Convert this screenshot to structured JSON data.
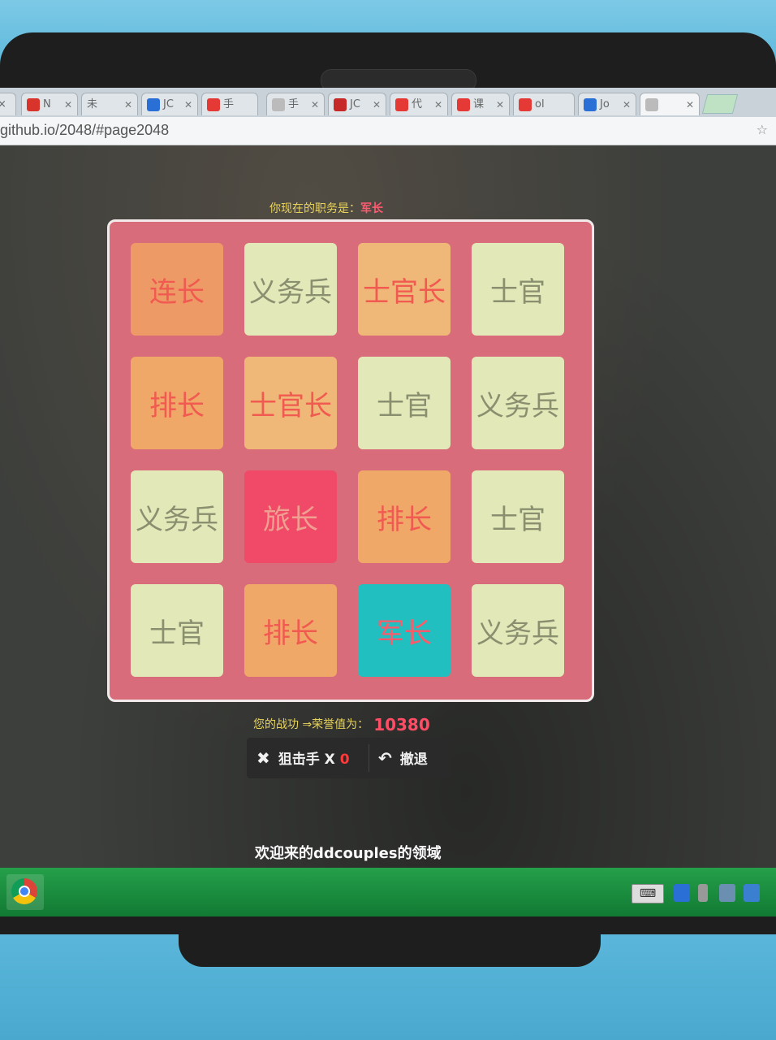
{
  "browser": {
    "tabs": [
      {
        "label": "×",
        "icon_color": "#dddddd"
      },
      {
        "label": "N",
        "icon_color": "#d9342b"
      },
      {
        "label": "未",
        "icon_color": "#dddddd"
      },
      {
        "label": "JC",
        "icon_color": "#2a6fd6"
      },
      {
        "label": "手",
        "icon_color": "#e53935"
      },
      {
        "label": "手",
        "icon_color": "#bbbbbb"
      },
      {
        "label": "JC",
        "icon_color": "#c62828"
      },
      {
        "label": "代",
        "icon_color": "#e53935"
      },
      {
        "label": "课",
        "icon_color": "#e53935"
      },
      {
        "label": "ol",
        "icon_color": "#e53935"
      },
      {
        "label": "Jo",
        "icon_color": "#2a6fd6"
      },
      {
        "label": "",
        "icon_color": "#bbbbbb"
      }
    ],
    "url": "github.io/2048/#page2048"
  },
  "game": {
    "rank_label": "你现在的职务是：",
    "rank_value": "军长",
    "score_label": "您的战功 ⇒荣誉值为：",
    "score_value": "10380",
    "sniper_label": "狙击手 X",
    "sniper_count": "0",
    "undo_label": "撤退",
    "welcome": "欢迎来的ddcouples的领域",
    "board": [
      [
        "连长",
        "义务兵",
        "士官长",
        "士官"
      ],
      [
        "排长",
        "士官长",
        "士官",
        "义务兵"
      ],
      [
        "义务兵",
        "旅长",
        "排长",
        "士官"
      ],
      [
        "士官",
        "排长",
        "军长",
        "义务兵"
      ]
    ],
    "tile_styles": {
      "义务兵": {
        "bg": "#e3e8b8",
        "fg": "#8a8f70"
      },
      "士官": {
        "bg": "#e3e8b8",
        "fg": "#8a8f70"
      },
      "士官长": {
        "bg": "#f0b878",
        "fg": "#f05a50"
      },
      "排长": {
        "bg": "#f0a868",
        "fg": "#f05a50"
      },
      "连长": {
        "bg": "#ee9a66",
        "fg": "#f05a50"
      },
      "旅长": {
        "bg": "#f04a68",
        "fg": "#f0a090"
      },
      "军长": {
        "bg": "#22bfc0",
        "fg": "#ff5a6a"
      }
    }
  }
}
